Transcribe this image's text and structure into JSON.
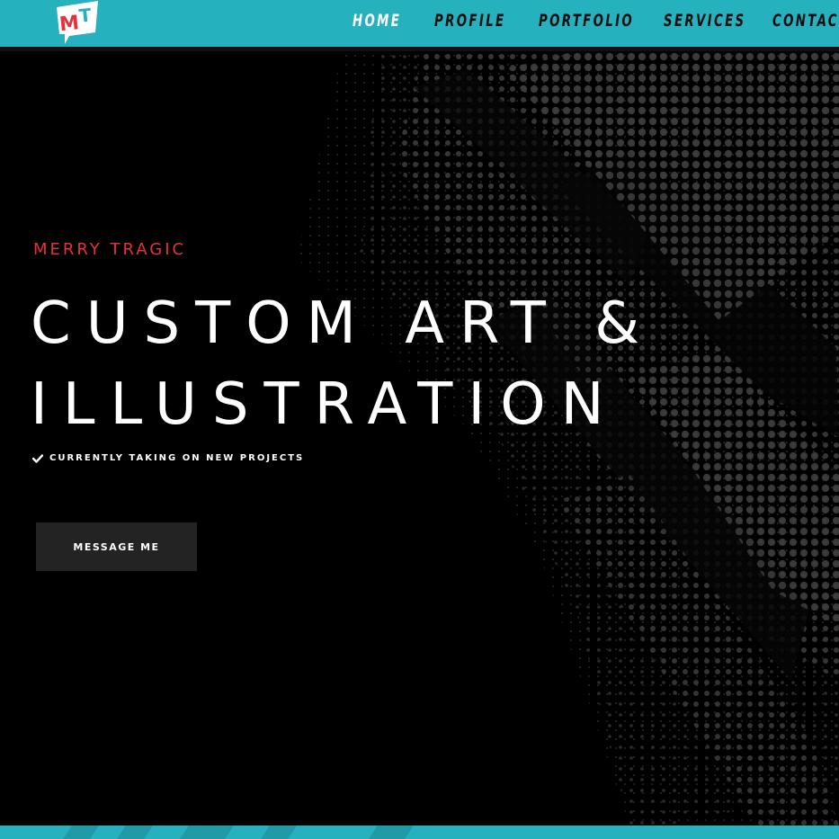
{
  "brand": {
    "logo_text": "MT",
    "logo_colors": {
      "panel": "#ffffff",
      "m": "#e8313a",
      "t": "#25b1be"
    }
  },
  "nav": {
    "items": [
      {
        "label": "HOME",
        "active": true
      },
      {
        "label": "PROFILE",
        "active": false
      },
      {
        "label": "PORTFOLIO",
        "active": false
      },
      {
        "label": "SERVICES",
        "active": false
      },
      {
        "label": "CONTACT",
        "active": false
      }
    ]
  },
  "hero": {
    "eyebrow": "MERRY TRAGIC",
    "headline_line1": "CUSTOM ART &",
    "headline_line2": "ILLUSTRATION",
    "status_icon": "check-icon",
    "status_text": "CURRENTLY TAKING ON NEW PROJECTS",
    "cta_label": "MESSAGE ME"
  },
  "colors": {
    "accent": "#25b1be",
    "highlight": "#e8313a",
    "background": "#000000",
    "button": "#232323",
    "text": "#ffffff"
  }
}
